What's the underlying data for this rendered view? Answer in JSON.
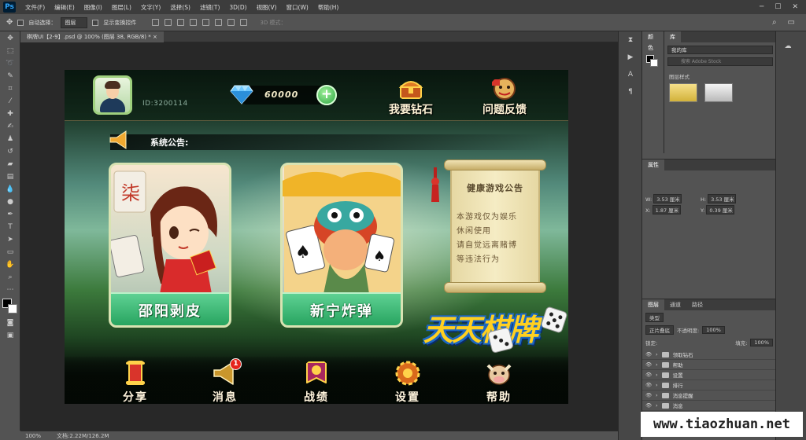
{
  "app": {
    "logo": "Ps"
  },
  "menu": [
    "文件(F)",
    "编辑(E)",
    "图像(I)",
    "图层(L)",
    "文字(Y)",
    "选择(S)",
    "滤镜(T)",
    "3D(D)",
    "视图(V)",
    "窗口(W)",
    "帮助(H)"
  ],
  "options": {
    "auto_select_label": "自动选择：",
    "auto_select_value": "图层",
    "show_transform_label": "显示变换控件",
    "mode_3d_label": "3D 模式："
  },
  "document_tab": "棋牌UI【2-9】.psd @ 100% (图层 38, RGB/8) *",
  "status": {
    "zoom": "100%",
    "doc_size": "文档:2.22M/126.2M"
  },
  "game": {
    "player_id": "ID:3200114",
    "diamonds": "60000",
    "plus_symbol": "+",
    "top_actions": [
      {
        "label": "我要钻石",
        "icon": "treasure-chest-icon"
      },
      {
        "label": "问题反馈",
        "icon": "feedback-icon"
      }
    ],
    "notice_label": "系统公告:",
    "games": [
      {
        "title": "邵阳剥皮"
      },
      {
        "title": "新宁炸弹"
      }
    ],
    "card_tile_text": "柒",
    "scroll": {
      "title": "健康游戏公告",
      "lines": [
        "本游戏仅为娱乐",
        "休闲使用",
        "请自觉远离赌博",
        "等违法行为"
      ]
    },
    "logo": "天天棋牌",
    "nav": [
      {
        "label": "分享",
        "icon": "share-scroll-icon"
      },
      {
        "label": "消息",
        "icon": "message-horn-icon",
        "badge": "1"
      },
      {
        "label": "战绩",
        "icon": "record-banner-icon"
      },
      {
        "label": "设置",
        "icon": "settings-gear-icon"
      },
      {
        "label": "帮助",
        "icon": "help-cow-icon"
      }
    ]
  },
  "panels": {
    "color_tab": "颜色",
    "library_tab": "库",
    "library_name": "我的库",
    "library_search": "搜索 Adobe Stock",
    "layer_styles": "图层样式",
    "properties_tab": "属性",
    "w": "3.53 厘米",
    "h": "3.53 厘米",
    "x": "1.87 厘米",
    "y": "0.39 厘米",
    "layer_tabs": [
      "图层",
      "通道",
      "路径"
    ],
    "filter_kind": "类型",
    "blend_mode": "正片叠底",
    "opacity_label": "不透明度:",
    "opacity": "100%",
    "lock_label": "锁定:",
    "fill_label": "填充:",
    "fill": "100%",
    "layers": [
      "领取钻石",
      "帮助",
      "设置",
      "排行",
      "消息提醒",
      "消息"
    ]
  },
  "watermark": "www.tiaozhuan.net",
  "colors": {
    "accent": "#31a8ff",
    "gold": "#ffd020",
    "green_label": "#28a460"
  }
}
